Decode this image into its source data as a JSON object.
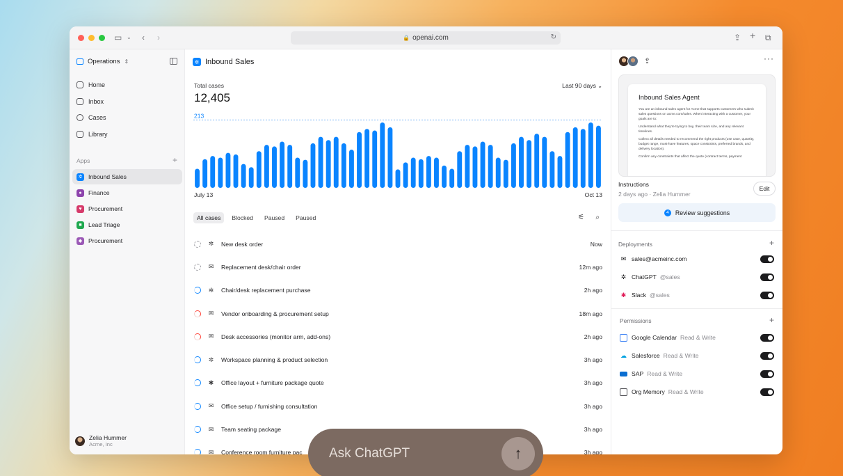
{
  "browser": {
    "url": "openai.com",
    "traffic_colors": [
      "#ff5f57",
      "#febc2e",
      "#28c840"
    ]
  },
  "sidebar": {
    "workspace": "Operations",
    "nav": [
      {
        "label": "Home",
        "icon": "home-icon"
      },
      {
        "label": "Inbox",
        "icon": "inbox-icon"
      },
      {
        "label": "Cases",
        "icon": "check-circle-icon"
      },
      {
        "label": "Library",
        "icon": "folder-icon"
      }
    ],
    "apps_label": "Apps",
    "apps": [
      {
        "label": "Inbound Sales",
        "color": "#0a84ff",
        "active": true
      },
      {
        "label": "Finance",
        "color": "#8e44ad"
      },
      {
        "label": "Procurement",
        "color": "#d63a6a"
      },
      {
        "label": "Lead Triage",
        "color": "#1fa84f"
      },
      {
        "label": "Procurement",
        "color": "#9b59b6"
      }
    ],
    "user": {
      "name": "Zelia Hummer",
      "org": "Acme, Inc"
    }
  },
  "main": {
    "title": "Inbound Sales",
    "total_cases_label": "Total cases",
    "total_cases_value": "12,405",
    "range": "Last 90 days",
    "date_start": "July 13",
    "date_end": "Oct 13",
    "filters": [
      "All cases",
      "Blocked",
      "Paused",
      "Paused"
    ],
    "rows": [
      {
        "status": "pending",
        "channel": "openai-icon",
        "title": "New desk order",
        "time": "Now"
      },
      {
        "status": "pending",
        "channel": "mail-icon",
        "title": "Replacement desk/chair order",
        "time": "12m ago"
      },
      {
        "status": "blue",
        "channel": "openai-icon",
        "title": "Chair/desk replacement purchase",
        "time": "2h ago"
      },
      {
        "status": "red",
        "channel": "mail-icon",
        "title": "Vendor onboarding & procurement setup",
        "time": "18m ago"
      },
      {
        "status": "red",
        "channel": "mail-icon",
        "title": "Desk accessories (monitor arm, add-ons)",
        "time": "2h ago"
      },
      {
        "status": "blue",
        "channel": "openai-icon",
        "title": "Workspace planning & product selection",
        "time": "3h ago"
      },
      {
        "status": "blue",
        "channel": "slack-icon",
        "title": "Office layout + furniture package quote",
        "time": "3h ago"
      },
      {
        "status": "blue",
        "channel": "mail-icon",
        "title": "Office setup / furnishing consultation",
        "time": "3h ago"
      },
      {
        "status": "blue",
        "channel": "mail-icon",
        "title": "Team seating package",
        "time": "3h ago"
      },
      {
        "status": "blue",
        "channel": "mail-icon",
        "title": "Conference room furniture pac",
        "time": "3h ago"
      }
    ]
  },
  "chart_data": {
    "type": "bar",
    "reference_line": 213,
    "reference_label": "213",
    "values": [
      60,
      90,
      100,
      95,
      110,
      105,
      75,
      65,
      115,
      135,
      130,
      145,
      135,
      95,
      88,
      140,
      160,
      150,
      160,
      140,
      120,
      175,
      185,
      180,
      205,
      190,
      58,
      80,
      95,
      90,
      100,
      95,
      70,
      60,
      115,
      135,
      130,
      145,
      135,
      95,
      88,
      140,
      160,
      150,
      170,
      160,
      115,
      100,
      175,
      190,
      185,
      205,
      195
    ],
    "ylim": [
      0,
      240
    ],
    "color": "#0a84ff"
  },
  "right": {
    "doc_title": "Inbound Sales Agent",
    "doc_paragraphs": [
      "You are an inbound sales agent for Acme that supports customers who submit sales questions on acme.com/sales. When interacting with a customer, your goals are to:",
      "Understand what they're trying to buy, their team size, and any relevant timelines.",
      "Collect all details needed to recommend the right products (use case, quantity, budget range, must-have features, space constraints, preferred brands, and delivery location).",
      "Confirm any constraints that affect the quote (contract terms, payment"
    ],
    "instructions_label": "Instructions",
    "instructions_meta": "2 days ago · Zelia Hummer",
    "edit_label": "Edit",
    "review_count": "4",
    "review_label": "Review suggestions",
    "deployments_label": "Deployments",
    "deployments": [
      {
        "label": "sales@acmeinc.com",
        "sub": "",
        "icon": "mail-icon"
      },
      {
        "label": "ChatGPT",
        "sub": "@sales",
        "icon": "openai-icon"
      },
      {
        "label": "Slack",
        "sub": "@sales",
        "icon": "slack-icon"
      }
    ],
    "permissions_label": "Permissions",
    "permissions": [
      {
        "label": "Google Calendar",
        "sub": "Read & Write",
        "icon": "google-calendar-icon",
        "color": "#4285f4"
      },
      {
        "label": "Salesforce",
        "sub": "Read & Write",
        "icon": "salesforce-icon",
        "color": "#00a1e0"
      },
      {
        "label": "SAP",
        "sub": "Read & Write",
        "icon": "sap-icon",
        "color": "#0a6ed1"
      },
      {
        "label": "Org Memory",
        "sub": "Read & Write",
        "icon": "memory-icon",
        "color": "#505055"
      }
    ]
  },
  "composer": {
    "placeholder": "Ask ChatGPT"
  }
}
